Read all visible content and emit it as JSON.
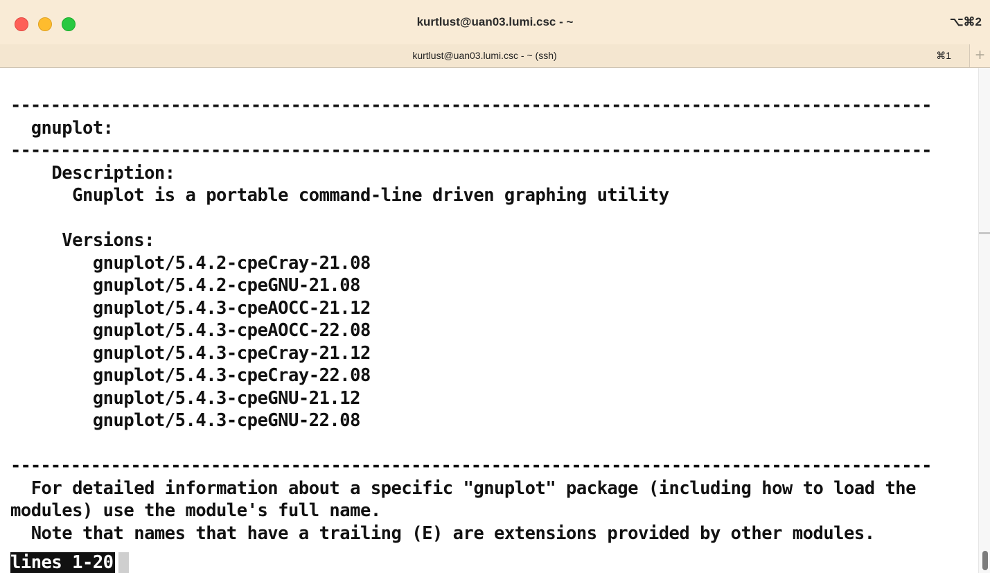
{
  "window": {
    "title": "kurtlust@uan03.lumi.csc - ~",
    "shortcut": "⌥⌘2"
  },
  "tab": {
    "title": "kurtlust@uan03.lumi.csc - ~ (ssh)",
    "shortcut": "⌘1",
    "add_label": "+"
  },
  "terminal": {
    "lines": [
      "--------------------------------------------------------------------------------------------",
      "  gnuplot:",
      "--------------------------------------------------------------------------------------------",
      "    Description:",
      "      Gnuplot is a portable command-line driven graphing utility",
      "",
      "     Versions:",
      "        gnuplot/5.4.2-cpeCray-21.08",
      "        gnuplot/5.4.2-cpeGNU-21.08",
      "        gnuplot/5.4.3-cpeAOCC-21.12",
      "        gnuplot/5.4.3-cpeAOCC-22.08",
      "        gnuplot/5.4.3-cpeCray-21.12",
      "        gnuplot/5.4.3-cpeCray-22.08",
      "        gnuplot/5.4.3-cpeGNU-21.12",
      "        gnuplot/5.4.3-cpeGNU-22.08",
      "",
      "--------------------------------------------------------------------------------------------",
      "  For detailed information about a specific \"gnuplot\" package (including how to load the",
      "modules) use the module's full name.",
      "  Note that names that have a trailing (E) are extensions provided by other modules."
    ],
    "status": "lines 1-20"
  },
  "colors": {
    "titlebar_bg": "#f9ebd6",
    "terminal_bg": "#ffffff",
    "terminal_fg": "#111111",
    "close": "#fe5f57",
    "minimize": "#febc2e",
    "maximize": "#28c840"
  }
}
